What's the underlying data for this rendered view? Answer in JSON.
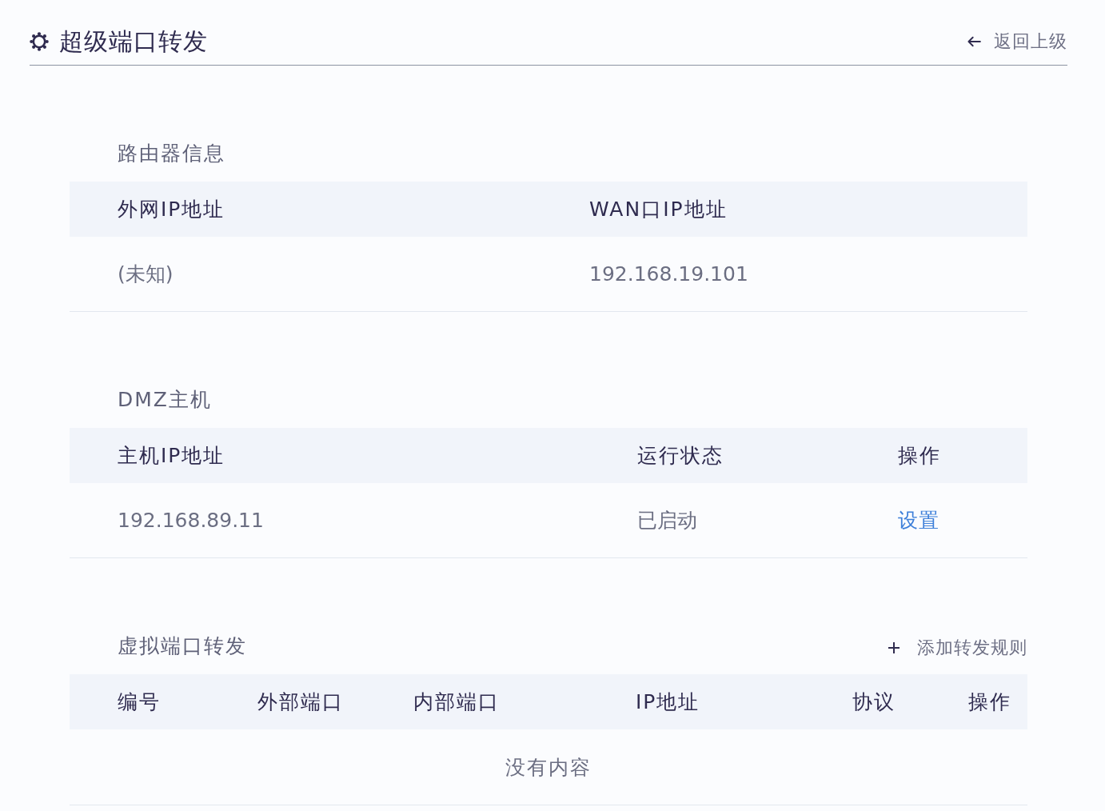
{
  "header": {
    "title": "超级端口转发",
    "back_link": "返回上级"
  },
  "router_info": {
    "title": "路由器信息",
    "columns": [
      "外网IP地址",
      "WAN口IP地址"
    ],
    "rows": [
      [
        {
          "kind": "text",
          "text": "(未知)"
        },
        {
          "kind": "text",
          "text": "192.168.19.101"
        }
      ]
    ]
  },
  "dmz_host": {
    "title": "DMZ主机",
    "columns": [
      "主机IP地址",
      "运行状态",
      "操作"
    ],
    "rows": [
      [
        {
          "kind": "text",
          "text": "192.168.89.11"
        },
        {
          "kind": "text",
          "text": "已启动"
        },
        {
          "kind": "link",
          "text": "设置"
        }
      ]
    ]
  },
  "port_forwarding": {
    "title": "虚拟端口转发",
    "add_button": "添加转发规则",
    "columns": [
      "编号",
      "外部端口",
      "内部端口",
      "IP地址",
      "协议",
      "操作"
    ],
    "empty_text": "没有内容"
  }
}
